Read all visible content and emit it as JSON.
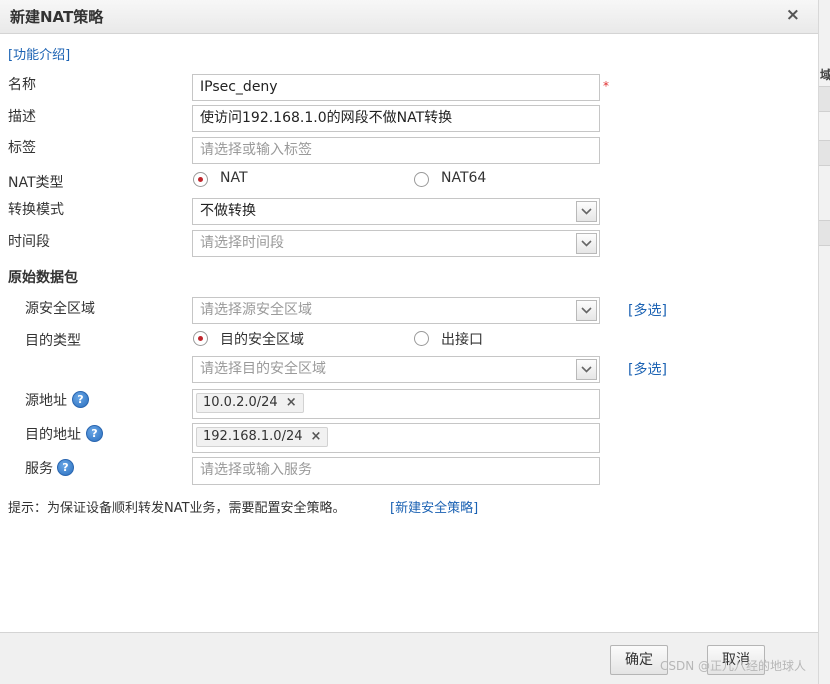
{
  "dialog": {
    "title": "新建NAT策略",
    "close_icon": "×"
  },
  "intro_link": "[功能介绍]",
  "labels": {
    "name": "名称",
    "desc": "描述",
    "tag": "标签",
    "nat_type": "NAT类型",
    "mode": "转换模式",
    "time": "时间段",
    "section": "原始数据包",
    "src_zone": "源安全区域",
    "dst_type": "目的类型",
    "src_addr": "源地址",
    "dst_addr": "目的地址",
    "service": "服务"
  },
  "fields": {
    "name_value": "IPsec_deny",
    "required_mark": "*",
    "desc_value": "使访问192.168.1.0的网段不做NAT转换",
    "tag_placeholder": "请选择或输入标签",
    "nat_options": [
      "NAT",
      "NAT64"
    ],
    "nat_selected": "NAT",
    "mode_value": "不做转换",
    "time_placeholder": "请选择时间段",
    "src_zone_placeholder": "请选择源安全区域",
    "multi_select_link": "[多选]",
    "dst_type_options": [
      "目的安全区域",
      "出接口"
    ],
    "dst_type_selected": "目的安全区域",
    "dst_zone_placeholder": "请选择目的安全区域",
    "src_addr_tags": [
      "10.0.2.0/24"
    ],
    "dst_addr_tags": [
      "192.168.1.0/24"
    ],
    "service_placeholder": "请选择或输入服务",
    "help_icon": "?",
    "tag_remove_icon": "×"
  },
  "hint": {
    "text": "提示：为保证设备顺利转发NAT业务，需要配置安全策略。",
    "link": "[新建安全策略]"
  },
  "footer": {
    "ok": "确定",
    "cancel": "取消",
    "watermark": "CSDN @正儿八经的地球人"
  },
  "side_strip": {
    "char": "域"
  },
  "colors": {
    "link": "#1b62b3",
    "radio_dot": "#c0272d",
    "required": "#e03030"
  }
}
